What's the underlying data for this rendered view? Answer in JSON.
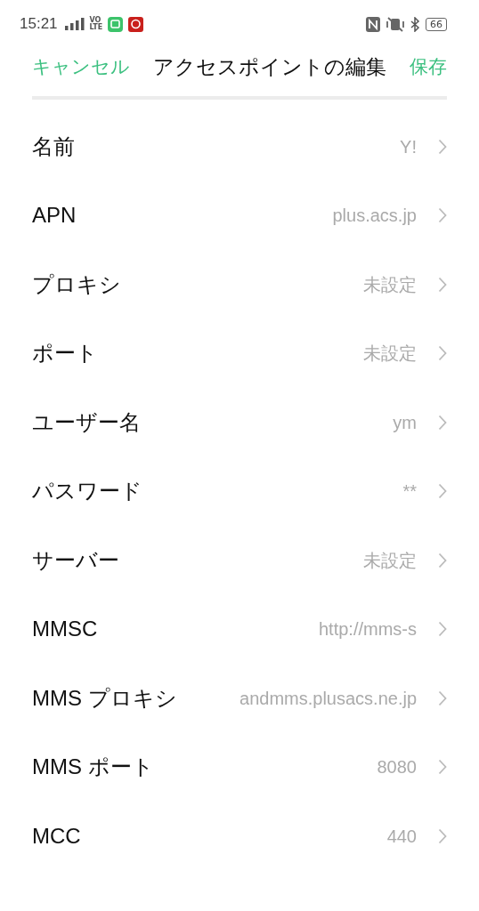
{
  "status_bar": {
    "time": "15:21",
    "network": [
      "VO",
      "LTE"
    ],
    "battery": "66"
  },
  "header": {
    "cancel": "キャンセル",
    "title": "アクセスポイントの編集",
    "save": "保存"
  },
  "rows": [
    {
      "label": "名前",
      "value": "Y!"
    },
    {
      "label": "APN",
      "value": "plus.acs.jp"
    },
    {
      "label": "プロキシ",
      "value": "未設定"
    },
    {
      "label": "ポート",
      "value": "未設定"
    },
    {
      "label": "ユーザー名",
      "value": "ym"
    },
    {
      "label": "パスワード",
      "value": "**"
    },
    {
      "label": "サーバー",
      "value": "未設定"
    },
    {
      "label": "MMSC",
      "value": "http://mms-s"
    },
    {
      "label": "MMS プロキシ",
      "value": "andmms.plusacs.ne.jp"
    },
    {
      "label": "MMS ポート",
      "value": "8080"
    },
    {
      "label": "MCC",
      "value": "440"
    }
  ]
}
